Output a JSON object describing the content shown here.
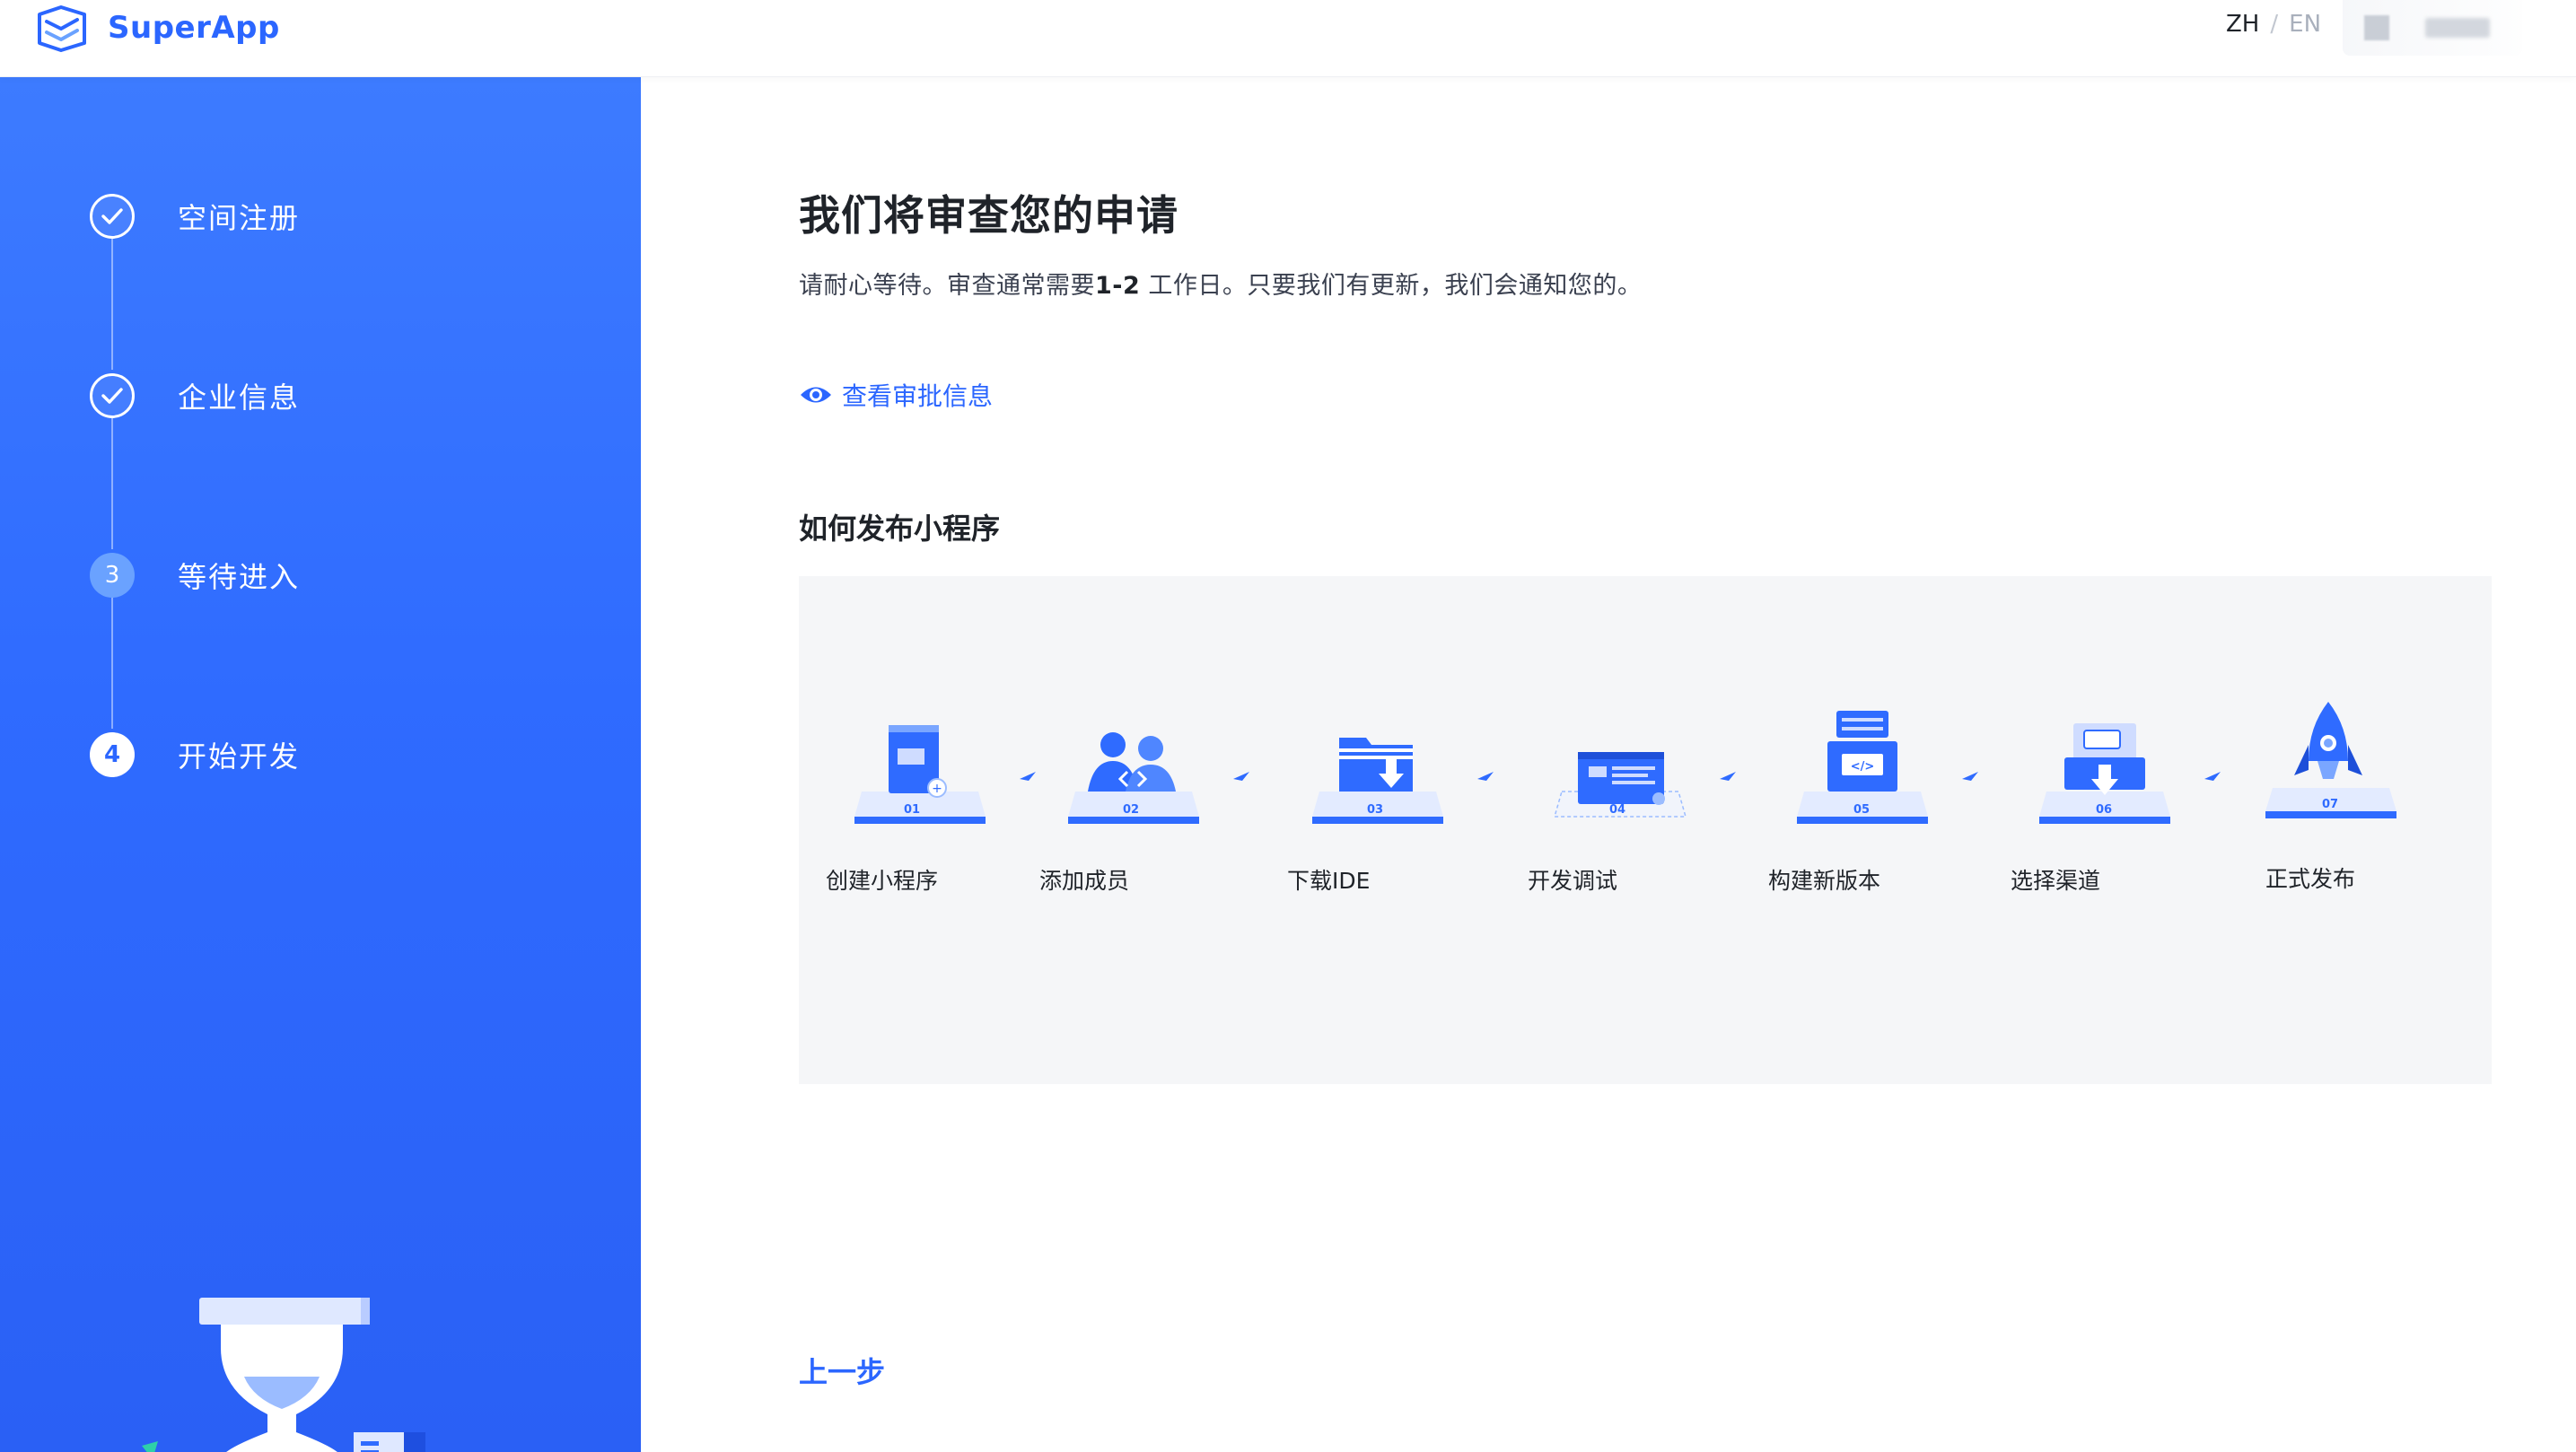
{
  "header": {
    "app_name": "SuperApp",
    "lang_zh": "ZH",
    "lang_separator": "/",
    "lang_en": "EN"
  },
  "sidebar": {
    "steps": [
      {
        "label": "空间注册",
        "status": "done"
      },
      {
        "label": "企业信息",
        "status": "done"
      },
      {
        "label": "等待进入",
        "status": "current",
        "number": "3"
      },
      {
        "label": "开始开发",
        "status": "pending",
        "number": "4"
      }
    ]
  },
  "main": {
    "title": "我们将审查您的申请",
    "subtitle_before": "请耐心等待。审查通常需要",
    "subtitle_bold": "1-2",
    "subtitle_after": " 工作日。只要我们有更新，我们会通知您的。",
    "view_link": "查看审批信息",
    "section_title": "如何发布小程序",
    "process_steps": [
      {
        "num": "01",
        "label": "创建小程序"
      },
      {
        "num": "02",
        "label": "添加成员"
      },
      {
        "num": "03",
        "label": "下载IDE"
      },
      {
        "num": "04",
        "label": "开发调试"
      },
      {
        "num": "05",
        "label": "构建新版本"
      },
      {
        "num": "06",
        "label": "选择渠道"
      },
      {
        "num": "07",
        "label": "正式发布"
      }
    ],
    "prev_button": "上一步"
  },
  "colors": {
    "brand": "#2b66ff",
    "sidebar_bg": "#3272ff",
    "process_bg": "#f5f6f8"
  }
}
